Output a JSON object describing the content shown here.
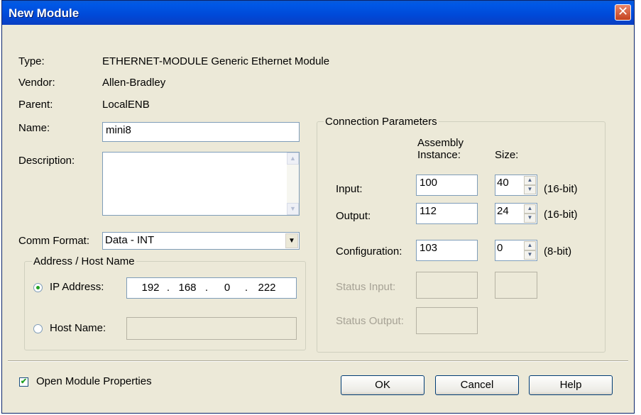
{
  "dialog": {
    "title": "New Module",
    "close_symbol": "✕"
  },
  "info": {
    "type_label": "Type:",
    "type_value": "ETHERNET-MODULE Generic Ethernet Module",
    "vendor_label": "Vendor:",
    "vendor_value": "Allen-Bradley",
    "parent_label": "Parent:",
    "parent_value": "LocalENB"
  },
  "name": {
    "label": "Name:",
    "value": "mini8"
  },
  "description": {
    "label": "Description:",
    "value": ""
  },
  "comm_format": {
    "label": "Comm Format:",
    "value": "Data - INT"
  },
  "address": {
    "group_title": "Address / Host Name",
    "ip_label": "IP Address:",
    "ip_octets": [
      "192",
      "168",
      "0",
      "222"
    ],
    "ip_dot": ".",
    "host_label": "Host Name:",
    "host_value": "",
    "selected": "ip"
  },
  "connection": {
    "group_title": "Connection Parameters",
    "col_assembly": "Assembly\nInstance:",
    "col_size": "Size:",
    "rows": [
      {
        "label": "Input:",
        "instance": "100",
        "size": "40",
        "unit": "(16-bit)"
      },
      {
        "label": "Output:",
        "instance": "112",
        "size": "24",
        "unit": "(16-bit)"
      },
      {
        "label": "Configuration:",
        "instance": "103",
        "size": "0",
        "unit": "(8-bit)"
      },
      {
        "label": "Status Input:",
        "instance": "",
        "size": ""
      },
      {
        "label": "Status Output:",
        "instance": ""
      }
    ]
  },
  "open_props": {
    "label": "Open Module Properties",
    "checked": true,
    "check_symbol": "✔"
  },
  "buttons": {
    "ok": "OK",
    "cancel": "Cancel",
    "help": "Help"
  },
  "icons": {
    "spin_up": "▲",
    "spin_down": "▼",
    "dropdown": "▼",
    "scroll_up": "▲",
    "scroll_down": "▼"
  }
}
